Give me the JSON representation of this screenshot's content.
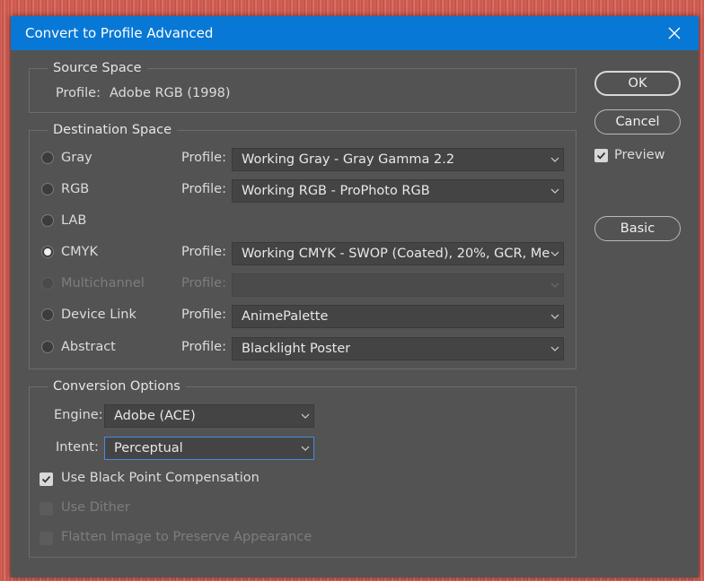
{
  "window": {
    "title": "Convert to Profile Advanced"
  },
  "source_space": {
    "legend": "Source Space",
    "profile_label": "Profile:",
    "profile_value": "Adobe RGB (1998)"
  },
  "destination_space": {
    "legend": "Destination Space",
    "selected": "CMYK",
    "rows": [
      {
        "label": "Gray",
        "profile_label": "Profile:",
        "profile_value": "Working Gray - Gray Gamma 2.2",
        "enabled": true
      },
      {
        "label": "RGB",
        "profile_label": "Profile:",
        "profile_value": "Working RGB - ProPhoto RGB",
        "enabled": true
      },
      {
        "label": "LAB",
        "enabled": true
      },
      {
        "label": "CMYK",
        "profile_label": "Profile:",
        "profile_value": "Working CMYK - SWOP (Coated), 20%, GCR, Me...",
        "enabled": true
      },
      {
        "label": "Multichannel",
        "profile_label": "Profile:",
        "profile_value": "",
        "enabled": false
      },
      {
        "label": "Device Link",
        "profile_label": "Profile:",
        "profile_value": "AnimePalette",
        "enabled": true
      },
      {
        "label": "Abstract",
        "profile_label": "Profile:",
        "profile_value": "Blacklight Poster",
        "enabled": true
      }
    ]
  },
  "conversion_options": {
    "legend": "Conversion Options",
    "engine_label": "Engine:",
    "engine_value": "Adobe (ACE)",
    "intent_label": "Intent:",
    "intent_value": "Perceptual",
    "black_point": {
      "label": "Use Black Point Compensation",
      "checked": true,
      "enabled": true
    },
    "dither": {
      "label": "Use Dither",
      "checked": false,
      "enabled": false
    },
    "flatten": {
      "label": "Flatten Image to Preserve Appearance",
      "checked": false,
      "enabled": false
    }
  },
  "buttons": {
    "ok": "OK",
    "cancel": "Cancel",
    "preview": {
      "label": "Preview",
      "checked": true
    },
    "basic": "Basic"
  },
  "colors": {
    "titlebar": "#0878d6",
    "dialog_bg": "#535353",
    "focus": "#4a8bdc"
  }
}
